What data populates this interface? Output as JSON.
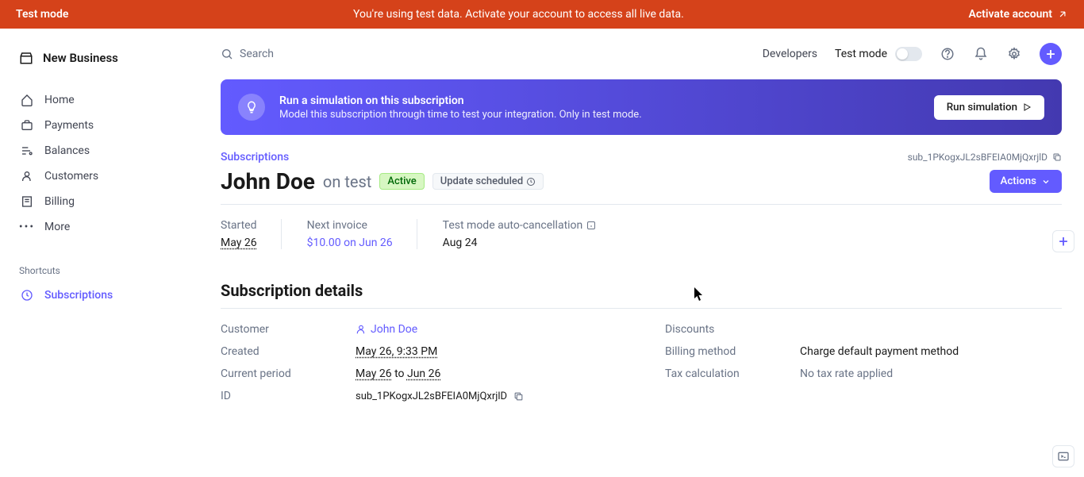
{
  "banner": {
    "left": "Test mode",
    "center": "You're using test data. Activate your account to access all live data.",
    "right": "Activate account"
  },
  "brand": "New Business",
  "nav": {
    "home": "Home",
    "payments": "Payments",
    "balances": "Balances",
    "customers": "Customers",
    "billing": "Billing",
    "more": "More"
  },
  "shortcuts": {
    "label": "Shortcuts",
    "subscriptions": "Subscriptions"
  },
  "topbar": {
    "search": "Search",
    "developers": "Developers",
    "test_mode": "Test mode"
  },
  "sim": {
    "title": "Run a simulation on this subscription",
    "sub": "Model this subscription through time to test your integration. Only in test mode.",
    "button": "Run simulation"
  },
  "page": {
    "breadcrumb": "Subscriptions",
    "sub_id": "sub_1PKogxJL2sBFEIA0MjQxrjlD",
    "customer": "John Doe",
    "on": "on",
    "product": "test",
    "badge_active": "Active",
    "badge_sched": "Update scheduled",
    "actions": "Actions"
  },
  "stats": {
    "started_label": "Started",
    "started": "May 26",
    "next_label": "Next invoice",
    "next": "$10.00 on Jun 26",
    "cancel_label": "Test mode auto-cancellation",
    "cancel": "Aug 24"
  },
  "details": {
    "heading": "Subscription details",
    "customer_label": "Customer",
    "customer": "John Doe",
    "created_label": "Created",
    "created": "May 26, 9:33 PM",
    "period_label": "Current period",
    "period_from": "May 26",
    "period_to": "to",
    "period_end": "Jun 26",
    "id_label": "ID",
    "id": "sub_1PKogxJL2sBFEIA0MjQxrjlD",
    "discounts_label": "Discounts",
    "billing_label": "Billing method",
    "billing": "Charge default payment method",
    "tax_label": "Tax calculation",
    "tax": "No tax rate applied"
  }
}
